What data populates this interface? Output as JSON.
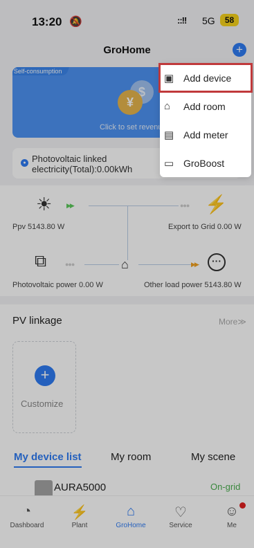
{
  "status_bar": {
    "time": "13:20",
    "network": "5G",
    "battery": "58"
  },
  "header": {
    "title": "GroHome"
  },
  "banner": {
    "tag": "Self-consumption",
    "text": "Click to set revenu"
  },
  "pv_linked": {
    "text": "Photovoltaic linked electricity(Total):0.00kWh"
  },
  "flow": {
    "ppv": "Ppv 5143.80 W",
    "export": "Export to Grid 0.00 W",
    "pv_power": "Photovoltaic power 0.00 W",
    "other_load": "Other load power 5143.80 W"
  },
  "linkage": {
    "title": "PV linkage",
    "more": "More≫",
    "customize": "Customize"
  },
  "tabs": [
    "My device list",
    "My room",
    "My scene"
  ],
  "device": {
    "name": "AURA5000",
    "status": "On-grid"
  },
  "nav": [
    "Dashboard",
    "Plant",
    "GroHome",
    "Service",
    "Me"
  ],
  "menu": [
    {
      "label": "Add device",
      "icon": "add-device-icon"
    },
    {
      "label": "Add room",
      "icon": "add-room-icon"
    },
    {
      "label": "Add meter",
      "icon": "meter-icon"
    },
    {
      "label": "GroBoost",
      "icon": "groboost-icon"
    }
  ],
  "colors": {
    "accent": "#2f7bf2",
    "highlight": "#c0393b",
    "ongrid": "#4caf50"
  }
}
